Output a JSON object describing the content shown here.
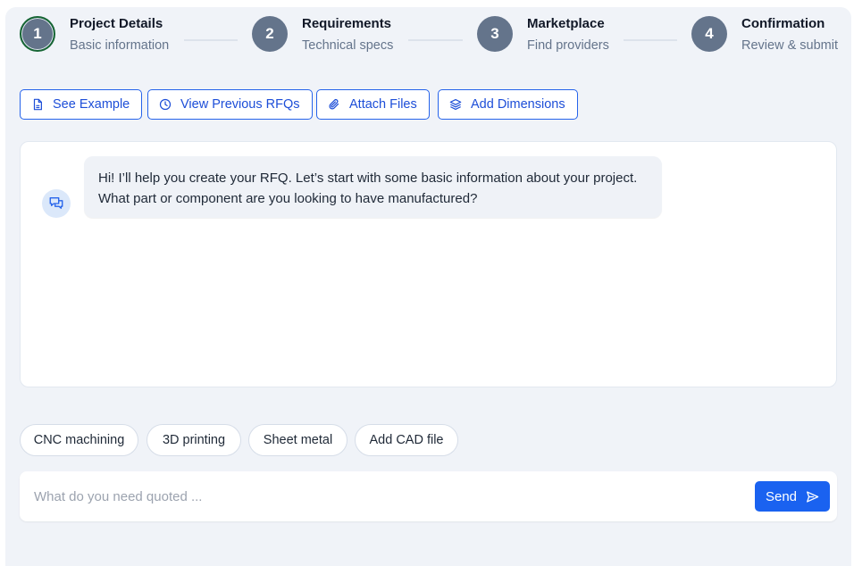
{
  "steps": [
    {
      "number": "1",
      "title": "Project Details",
      "subtitle": "Basic information",
      "active": true
    },
    {
      "number": "2",
      "title": "Requirements",
      "subtitle": "Technical specs",
      "active": false
    },
    {
      "number": "3",
      "title": "Marketplace",
      "subtitle": "Find providers",
      "active": false
    },
    {
      "number": "4",
      "title": "Confirmation",
      "subtitle": "Review & submit",
      "active": false
    }
  ],
  "toolbar": {
    "see_example": "See Example",
    "view_previous": "View Previous RFQs",
    "attach_files": "Attach Files",
    "add_dimensions": "Add Dimensions"
  },
  "chat": {
    "assistant_message": "Hi! I’ll help you create your RFQ. Let’s start with some basic information about your project. What part or component are you looking to have manufactured?"
  },
  "suggestions": [
    "CNC machining",
    "3D printing",
    "Sheet metal",
    "Add CAD file"
  ],
  "composer": {
    "placeholder": "What do you need quoted ...",
    "value": "",
    "send_label": "Send"
  },
  "colors": {
    "accent": "#1a62f0",
    "step_circle": "#64748b",
    "active_step_ring": "#166534",
    "panel_bg": "#f0f3f8"
  },
  "icons": {
    "see_example": "document-icon",
    "view_previous": "clock-icon",
    "attach_files": "paperclip-icon",
    "add_dimensions": "layers-icon",
    "avatar": "chat-bubbles-icon",
    "send": "send-icon"
  }
}
